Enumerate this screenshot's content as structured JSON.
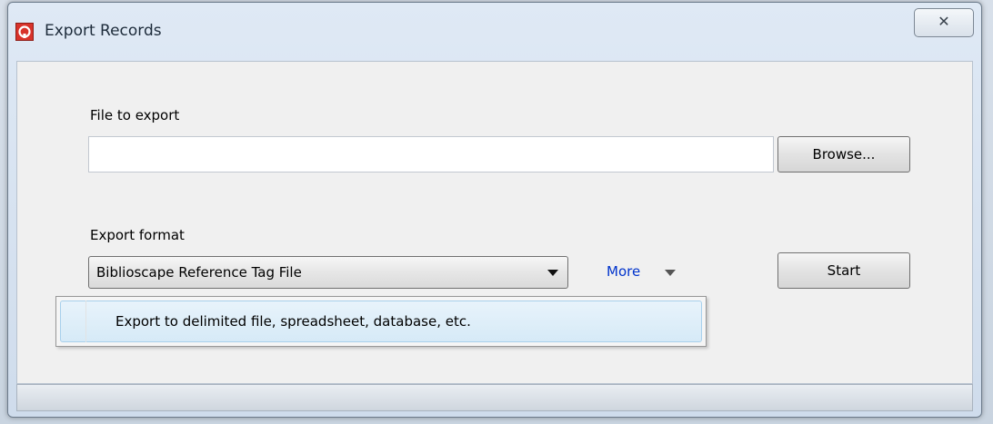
{
  "window": {
    "title": "Export Records",
    "close_glyph": "✕"
  },
  "file_section": {
    "label": "File to export",
    "value": "",
    "browse_label": "Browse..."
  },
  "format_section": {
    "label": "Export format",
    "selected": "Biblioscape Reference Tag File",
    "more_label": "More",
    "start_label": "Start"
  },
  "more_menu": {
    "items": [
      {
        "label": "Export to delimited file, spreadsheet, database, etc."
      }
    ]
  },
  "colors": {
    "link": "#0033cc",
    "app_icon": "#d8332b",
    "menu_highlight": "#d6eaf7"
  },
  "icons": {
    "app": "biblioscape-app-icon",
    "close": "close-icon",
    "dropdown": "chevron-down-icon"
  }
}
